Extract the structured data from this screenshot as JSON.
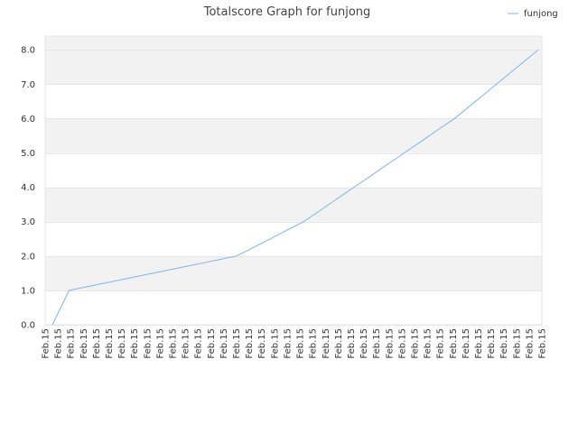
{
  "chart_data": {
    "type": "line",
    "title": "Totalscore Graph for funjong",
    "xlabel": "",
    "ylabel": "",
    "ylim": [
      0,
      8.4
    ],
    "y_ticks": [
      "0.0",
      "1.0",
      "2.0",
      "3.0",
      "4.0",
      "5.0",
      "6.0",
      "7.0",
      "8.0"
    ],
    "x": [
      "Feb.15",
      "Feb.15",
      "Feb.15",
      "Feb.15",
      "Feb.15",
      "Feb.15",
      "Feb.15",
      "Feb.15",
      "Feb.15",
      "Feb.15",
      "Feb.15",
      "Feb.15",
      "Feb.15",
      "Feb.15",
      "Feb.15",
      "Feb.15",
      "Feb.15",
      "Feb.15",
      "Feb.15",
      "Feb.15",
      "Feb.15",
      "Feb.15",
      "Feb.15",
      "Feb.15",
      "Feb.15",
      "Feb.15",
      "Feb.15",
      "Feb.15",
      "Feb.15",
      "Feb.15",
      "Feb.15",
      "Feb.15",
      "Feb.15",
      "Feb.15",
      "Feb.15",
      "Feb.15",
      "Feb.15",
      "Feb.15",
      "Feb.15",
      "Feb.15"
    ],
    "series": [
      {
        "name": "funjong",
        "color": "#7cb5ec",
        "values": [
          0,
          1,
          1.1,
          1.2,
          1.3,
          1.4,
          1.5,
          1.6,
          1.7,
          1.8,
          1.9,
          2,
          2.25,
          2.5,
          2.75,
          3,
          3.33,
          3.67,
          4,
          4.33,
          4.67,
          5,
          5.33,
          5.67,
          6,
          6.4,
          6.8,
          7.2,
          7.6,
          8
        ]
      }
    ],
    "grid": true,
    "band_color": "#f2f2f2",
    "legend_position": "top-right"
  }
}
